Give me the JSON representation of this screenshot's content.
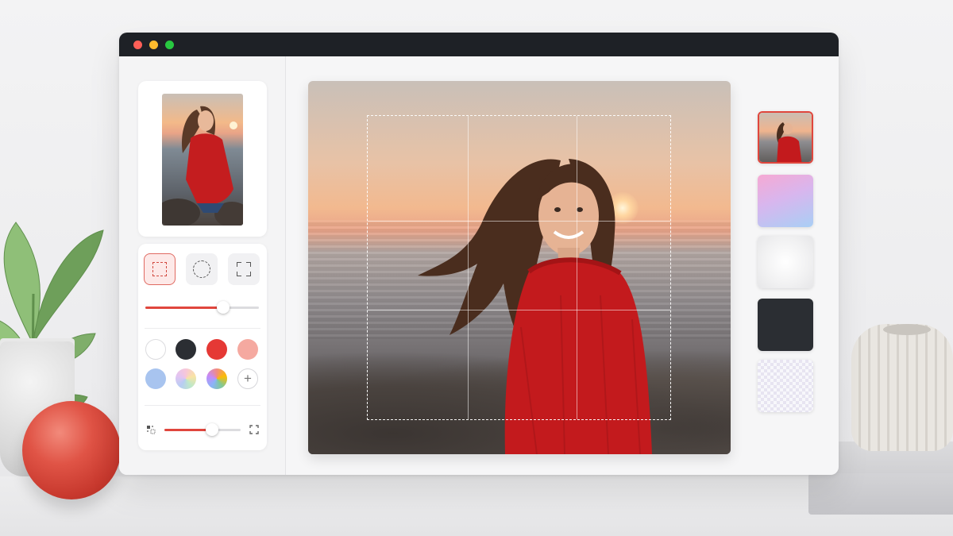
{
  "window": {
    "traffic_lights": [
      "#ff5f57",
      "#febc2e",
      "#28c840"
    ]
  },
  "sidebar": {
    "preview_icon": "portrait-preview-icon",
    "shape_tools": [
      {
        "name": "rectangle-select-icon",
        "active": true
      },
      {
        "name": "ellipse-select-icon",
        "active": false
      },
      {
        "name": "free-crop-icon",
        "active": false
      }
    ],
    "size_slider": {
      "value": 0.68
    },
    "colors": [
      "#ffffff",
      "#2b2e33",
      "#e53935",
      "#f5a9a0",
      "#a8c4ef",
      "conic-gradient",
      "rainbow-gradient"
    ],
    "add_color_label": "+",
    "feather_slider": {
      "value": 0.6
    }
  },
  "canvas": {
    "crop_grid": "3x3"
  },
  "backgrounds": {
    "items": [
      {
        "name": "original-photo",
        "selected": true
      },
      {
        "name": "pink-blue-gradient",
        "selected": false
      },
      {
        "name": "soft-white",
        "selected": false
      },
      {
        "name": "dark-charcoal",
        "selected": false
      },
      {
        "name": "transparent-checker",
        "selected": false
      }
    ]
  }
}
